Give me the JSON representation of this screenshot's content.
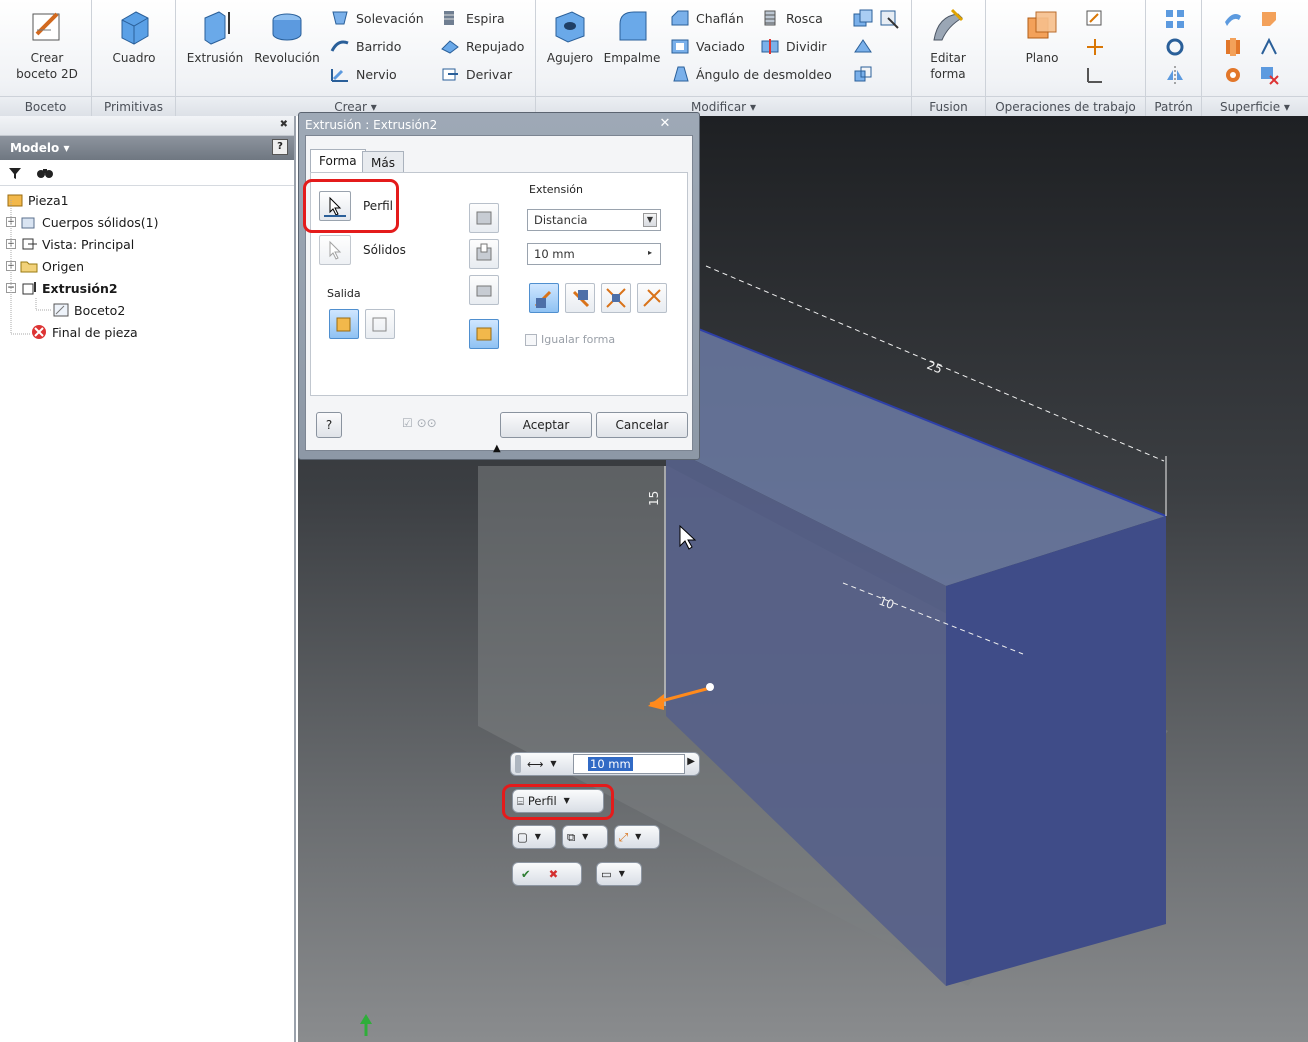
{
  "ribbon": {
    "panels": {
      "sketch": "Boceto",
      "primitives": "Primitivas",
      "create": "Crear",
      "modify": "Modificar",
      "fusion": "Fusion",
      "work_features": "Operaciones de trabajo",
      "pattern": "Patrón",
      "surface": "Superficie"
    },
    "buttons": {
      "create_sketch": "Crear boceto 2D",
      "box": "Cuadro",
      "extrude": "Extrusión",
      "revolve": "Revolución",
      "loft": "Solevación",
      "sweep": "Barrido",
      "rib": "Nervio",
      "coil": "Espira",
      "emboss": "Repujado",
      "derive": "Derivar",
      "hole": "Agujero",
      "fillet": "Empalme",
      "chamfer": "Chaflán",
      "shell": "Vaciado",
      "draft": "Ángulo de desmoldeo",
      "thread": "Rosca",
      "split": "Dividir",
      "edit_form": "Editar forma",
      "plane": "Plano"
    }
  },
  "browser": {
    "header": "Modelo",
    "help": "?",
    "tree": [
      {
        "label": "Pieza1"
      },
      {
        "label": "Cuerpos sólidos(1)"
      },
      {
        "label": "Vista: Principal"
      },
      {
        "label": "Origen"
      },
      {
        "label": "Extrusión2"
      },
      {
        "label": "Boceto2"
      },
      {
        "label": "Final de pieza"
      }
    ]
  },
  "dialog": {
    "title": "Extrusión : Extrusión2",
    "tabs": [
      "Forma",
      "Más"
    ],
    "profile_label": "Perfil",
    "solids_label": "Sólidos",
    "output_label": "Salida",
    "extents_label": "Extensión",
    "extents_value": "Distancia",
    "distance_value": "10 mm",
    "match_shape": "Igualar forma",
    "help": "?",
    "ok": "Aceptar",
    "cancel": "Cancelar"
  },
  "viewport": {
    "dim_width": "25",
    "dim_height": "15",
    "dim_depth": "10"
  },
  "mini_toolbar": {
    "distance_value": "10 mm",
    "profile_label": "Perfil"
  },
  "colors": {
    "highlight": "#e41b1b",
    "accent": "#4f8fcf",
    "solid_front": "#3f4c88"
  }
}
